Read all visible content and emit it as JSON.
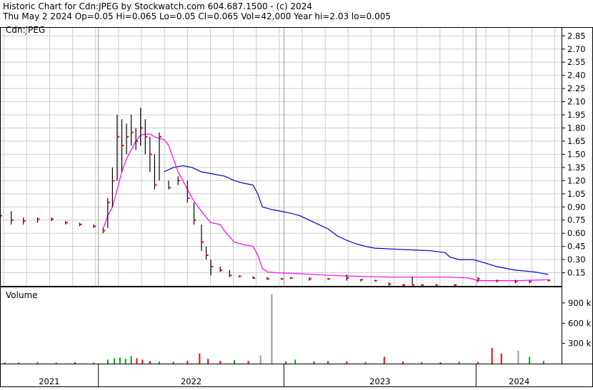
{
  "header": {
    "line1": "Historic Chart for Cdn:JPEG by Stockwatch.com 604.687.1500 - (c) 2024",
    "line2": "Thu May  2 2024  Op=0.05  Hi=0.065  Lo=0.05  Cl=0.065  Vol=42,000  Year hi=2.03  lo=0.005"
  },
  "colors": {
    "price_bar": "#000000",
    "close_mark": "#ff0000",
    "ma_short": "#ff00ff",
    "ma_long": "#0000cc",
    "volume_up": "#00aa00",
    "volume_down": "#ff0000",
    "volume_neutral": "#999999",
    "grid": "#cccccc",
    "frame": "#000000"
  },
  "chart_data": [
    {
      "type": "line",
      "title": "Cdn:JPEG",
      "ylim": [
        0,
        2.95
      ],
      "grid": true,
      "y_ticks": [
        "2.85",
        "2.70",
        "2.55",
        "2.40",
        "2.25",
        "2.10",
        "1.95",
        "1.80",
        "1.65",
        "1.50",
        "1.35",
        "1.20",
        "1.05",
        "0.90",
        "0.75",
        "0.60",
        "0.45",
        "0.30",
        "0.15"
      ],
      "x_period_labels": [
        "2021",
        "2022",
        "2023",
        "2024"
      ],
      "price_points_note": "",
      "price": [
        {
          "t": 0.0,
          "lo": 0.62,
          "hi": 1.0,
          "c": 0.8
        },
        {
          "t": 1.2,
          "lo": 0.7,
          "hi": 0.85,
          "c": 0.75
        },
        {
          "t": 2.5,
          "lo": 0.7,
          "hi": 0.78,
          "c": 0.74
        },
        {
          "t": 4.0,
          "lo": 0.72,
          "hi": 0.78,
          "c": 0.76
        },
        {
          "t": 5.5,
          "lo": 0.74,
          "hi": 0.78,
          "c": 0.76
        },
        {
          "t": 7.0,
          "lo": 0.7,
          "hi": 0.74,
          "c": 0.72
        },
        {
          "t": 8.5,
          "lo": 0.68,
          "hi": 0.72,
          "c": 0.7
        },
        {
          "t": 10.0,
          "lo": 0.66,
          "hi": 0.7,
          "c": 0.68
        },
        {
          "t": 11.0,
          "lo": 0.6,
          "hi": 0.66,
          "c": 0.63
        },
        {
          "t": 11.5,
          "lo": 0.66,
          "hi": 1.0,
          "c": 0.95
        },
        {
          "t": 12.0,
          "lo": 0.9,
          "hi": 1.35,
          "c": 1.2
        },
        {
          "t": 12.5,
          "lo": 1.2,
          "hi": 1.95,
          "c": 1.7
        },
        {
          "t": 13.0,
          "lo": 1.3,
          "hi": 1.9,
          "c": 1.6
        },
        {
          "t": 13.5,
          "lo": 1.5,
          "hi": 1.85,
          "c": 1.7
        },
        {
          "t": 14.0,
          "lo": 1.6,
          "hi": 1.95,
          "c": 1.75
        },
        {
          "t": 14.5,
          "lo": 1.55,
          "hi": 1.8,
          "c": 1.65
        },
        {
          "t": 15.0,
          "lo": 1.6,
          "hi": 2.03,
          "c": 1.8
        },
        {
          "t": 15.5,
          "lo": 1.5,
          "hi": 1.9,
          "c": 1.7
        },
        {
          "t": 16.0,
          "lo": 1.3,
          "hi": 1.7,
          "c": 1.5
        },
        {
          "t": 16.5,
          "lo": 1.1,
          "hi": 1.5,
          "c": 1.15
        },
        {
          "t": 17.0,
          "lo": 1.2,
          "hi": 1.75,
          "c": 1.7
        },
        {
          "t": 18.0,
          "lo": 1.1,
          "hi": 1.2,
          "c": 1.12
        },
        {
          "t": 19.0,
          "lo": 1.15,
          "hi": 1.25,
          "c": 1.2
        },
        {
          "t": 20.0,
          "lo": 0.95,
          "hi": 1.2,
          "c": 1.0
        },
        {
          "t": 20.7,
          "lo": 0.7,
          "hi": 0.95,
          "c": 0.75
        },
        {
          "t": 21.5,
          "lo": 0.4,
          "hi": 0.7,
          "c": 0.5
        },
        {
          "t": 22.0,
          "lo": 0.3,
          "hi": 0.45,
          "c": 0.35
        },
        {
          "t": 22.5,
          "lo": 0.12,
          "hi": 0.3,
          "c": 0.22
        },
        {
          "t": 23.5,
          "lo": 0.16,
          "hi": 0.22,
          "c": 0.18
        },
        {
          "t": 24.5,
          "lo": 0.1,
          "hi": 0.18,
          "c": 0.12
        },
        {
          "t": 25.5,
          "lo": 0.1,
          "hi": 0.12,
          "c": 0.11
        },
        {
          "t": 27.0,
          "lo": 0.08,
          "hi": 0.11,
          "c": 0.09
        },
        {
          "t": 28.5,
          "lo": 0.07,
          "hi": 0.1,
          "c": 0.08
        },
        {
          "t": 30.0,
          "lo": 0.07,
          "hi": 0.09,
          "c": 0.08
        },
        {
          "t": 31.0,
          "lo": 0.08,
          "hi": 0.1,
          "c": 0.09
        },
        {
          "t": 33.0,
          "lo": 0.06,
          "hi": 0.1,
          "c": 0.08
        },
        {
          "t": 35.0,
          "lo": 0.07,
          "hi": 0.09,
          "c": 0.08
        },
        {
          "t": 37.0,
          "lo": 0.06,
          "hi": 0.13,
          "c": 0.09
        },
        {
          "t": 38.5,
          "lo": 0.05,
          "hi": 0.08,
          "c": 0.07
        },
        {
          "t": 40.0,
          "lo": 0.05,
          "hi": 0.07,
          "c": 0.06
        },
        {
          "t": 41.5,
          "lo": 0.0,
          "hi": 0.04,
          "c": 0.02
        },
        {
          "t": 43.0,
          "lo": 0.0,
          "hi": 0.02,
          "c": 0.01
        },
        {
          "t": 44.0,
          "lo": 0.005,
          "hi": 0.1,
          "c": 0.01
        },
        {
          "t": 45.0,
          "lo": 0.0,
          "hi": 0.02,
          "c": 0.01
        },
        {
          "t": 46.5,
          "lo": 0.005,
          "hi": 0.02,
          "c": 0.01
        },
        {
          "t": 48.5,
          "lo": 0.0,
          "hi": 0.02,
          "c": 0.01
        },
        {
          "t": 51.0,
          "lo": 0.04,
          "hi": 0.1,
          "c": 0.08
        },
        {
          "t": 53.0,
          "lo": 0.04,
          "hi": 0.07,
          "c": 0.06
        },
        {
          "t": 55.0,
          "lo": 0.03,
          "hi": 0.07,
          "c": 0.05
        },
        {
          "t": 56.5,
          "lo": 0.03,
          "hi": 0.06,
          "c": 0.05
        },
        {
          "t": 58.5,
          "lo": 0.05,
          "hi": 0.065,
          "c": 0.065
        }
      ],
      "ma_short": [
        {
          "t": 11.0,
          "v": 0.65
        },
        {
          "t": 11.5,
          "v": 0.8
        },
        {
          "t": 12.0,
          "v": 0.9
        },
        {
          "t": 12.5,
          "v": 1.1
        },
        {
          "t": 13.0,
          "v": 1.3
        },
        {
          "t": 13.5,
          "v": 1.45
        },
        {
          "t": 14.0,
          "v": 1.55
        },
        {
          "t": 14.5,
          "v": 1.65
        },
        {
          "t": 15.0,
          "v": 1.72
        },
        {
          "t": 15.5,
          "v": 1.73
        },
        {
          "t": 16.0,
          "v": 1.73
        },
        {
          "t": 16.5,
          "v": 1.7
        },
        {
          "t": 17.0,
          "v": 1.68
        },
        {
          "t": 17.5,
          "v": 1.67
        },
        {
          "t": 18.0,
          "v": 1.6
        },
        {
          "t": 18.5,
          "v": 1.45
        },
        {
          "t": 19.0,
          "v": 1.3
        },
        {
          "t": 19.5,
          "v": 1.2
        },
        {
          "t": 20.0,
          "v": 1.1
        },
        {
          "t": 20.5,
          "v": 1.0
        },
        {
          "t": 21.0,
          "v": 0.92
        },
        {
          "t": 21.5,
          "v": 0.85
        },
        {
          "t": 22.0,
          "v": 0.78
        },
        {
          "t": 22.5,
          "v": 0.72
        },
        {
          "t": 23.5,
          "v": 0.7
        },
        {
          "t": 24.0,
          "v": 0.62
        },
        {
          "t": 25.0,
          "v": 0.5
        },
        {
          "t": 26.0,
          "v": 0.47
        },
        {
          "t": 27.0,
          "v": 0.45
        },
        {
          "t": 27.5,
          "v": 0.35
        },
        {
          "t": 28.0,
          "v": 0.2
        },
        {
          "t": 28.5,
          "v": 0.16
        },
        {
          "t": 29.5,
          "v": 0.15
        },
        {
          "t": 32.0,
          "v": 0.14
        },
        {
          "t": 35.0,
          "v": 0.12
        },
        {
          "t": 38.0,
          "v": 0.11
        },
        {
          "t": 42.0,
          "v": 0.1
        },
        {
          "t": 44.0,
          "v": 0.1
        },
        {
          "t": 48.0,
          "v": 0.1
        },
        {
          "t": 50.0,
          "v": 0.09
        },
        {
          "t": 51.0,
          "v": 0.06
        },
        {
          "t": 52.0,
          "v": 0.06
        },
        {
          "t": 55.0,
          "v": 0.06
        },
        {
          "t": 58.5,
          "v": 0.07
        }
      ],
      "ma_long": [
        {
          "t": 17.5,
          "v": 1.3
        },
        {
          "t": 18.5,
          "v": 1.35
        },
        {
          "t": 19.5,
          "v": 1.37
        },
        {
          "t": 20.5,
          "v": 1.35
        },
        {
          "t": 21.5,
          "v": 1.3
        },
        {
          "t": 22.5,
          "v": 1.28
        },
        {
          "t": 24.0,
          "v": 1.25
        },
        {
          "t": 25.0,
          "v": 1.2
        },
        {
          "t": 26.0,
          "v": 1.17
        },
        {
          "t": 27.0,
          "v": 1.15
        },
        {
          "t": 27.5,
          "v": 1.05
        },
        {
          "t": 28.0,
          "v": 0.9
        },
        {
          "t": 29.0,
          "v": 0.87
        },
        {
          "t": 30.0,
          "v": 0.85
        },
        {
          "t": 31.0,
          "v": 0.83
        },
        {
          "t": 32.0,
          "v": 0.8
        },
        {
          "t": 33.0,
          "v": 0.75
        },
        {
          "t": 34.0,
          "v": 0.7
        },
        {
          "t": 35.0,
          "v": 0.65
        },
        {
          "t": 36.0,
          "v": 0.57
        },
        {
          "t": 37.0,
          "v": 0.52
        },
        {
          "t": 38.0,
          "v": 0.48
        },
        {
          "t": 39.0,
          "v": 0.45
        },
        {
          "t": 40.0,
          "v": 0.43
        },
        {
          "t": 42.0,
          "v": 0.42
        },
        {
          "t": 44.0,
          "v": 0.41
        },
        {
          "t": 46.0,
          "v": 0.4
        },
        {
          "t": 47.5,
          "v": 0.38
        },
        {
          "t": 48.0,
          "v": 0.33
        },
        {
          "t": 49.0,
          "v": 0.3
        },
        {
          "t": 50.5,
          "v": 0.3
        },
        {
          "t": 51.5,
          "v": 0.27
        },
        {
          "t": 53.0,
          "v": 0.22
        },
        {
          "t": 55.0,
          "v": 0.18
        },
        {
          "t": 57.0,
          "v": 0.16
        },
        {
          "t": 58.5,
          "v": 0.13
        }
      ]
    },
    {
      "type": "bar",
      "title": "Volume",
      "ylim": [
        0,
        1100000
      ],
      "y_ticks": [
        "900 k",
        "600 k",
        "300 k"
      ],
      "volume": [
        {
          "t": 0.5,
          "v": 20000,
          "dir": "up"
        },
        {
          "t": 2.0,
          "v": 15000,
          "dir": "down"
        },
        {
          "t": 4.0,
          "v": 25000,
          "dir": "up"
        },
        {
          "t": 6.0,
          "v": 15000,
          "dir": "up"
        },
        {
          "t": 8.0,
          "v": 20000,
          "dir": "down"
        },
        {
          "t": 10.0,
          "v": 15000,
          "dir": "up"
        },
        {
          "t": 11.5,
          "v": 60000,
          "dir": "up"
        },
        {
          "t": 12.2,
          "v": 80000,
          "dir": "up"
        },
        {
          "t": 12.8,
          "v": 90000,
          "dir": "up"
        },
        {
          "t": 13.4,
          "v": 70000,
          "dir": "up"
        },
        {
          "t": 14.0,
          "v": 110000,
          "dir": "up"
        },
        {
          "t": 14.6,
          "v": 80000,
          "dir": "down"
        },
        {
          "t": 15.2,
          "v": 60000,
          "dir": "down"
        },
        {
          "t": 16.0,
          "v": 40000,
          "dir": "down"
        },
        {
          "t": 17.0,
          "v": 30000,
          "dir": "up"
        },
        {
          "t": 18.5,
          "v": 25000,
          "dir": "down"
        },
        {
          "t": 20.0,
          "v": 40000,
          "dir": "down"
        },
        {
          "t": 21.3,
          "v": 150000,
          "dir": "down"
        },
        {
          "t": 22.2,
          "v": 70000,
          "dir": "down"
        },
        {
          "t": 23.5,
          "v": 40000,
          "dir": "down"
        },
        {
          "t": 25.0,
          "v": 50000,
          "dir": "up"
        },
        {
          "t": 26.5,
          "v": 40000,
          "dir": "down"
        },
        {
          "t": 27.8,
          "v": 120000,
          "dir": "neutral"
        },
        {
          "t": 29.0,
          "v": 1030000,
          "dir": "neutral"
        },
        {
          "t": 30.5,
          "v": 30000,
          "dir": "down"
        },
        {
          "t": 31.5,
          "v": 60000,
          "dir": "up"
        },
        {
          "t": 33.5,
          "v": 30000,
          "dir": "down"
        },
        {
          "t": 35.0,
          "v": 40000,
          "dir": "up"
        },
        {
          "t": 37.0,
          "v": 30000,
          "dir": "down"
        },
        {
          "t": 39.0,
          "v": 25000,
          "dir": "up"
        },
        {
          "t": 41.0,
          "v": 100000,
          "dir": "down"
        },
        {
          "t": 43.0,
          "v": 30000,
          "dir": "down"
        },
        {
          "t": 45.0,
          "v": 25000,
          "dir": "up"
        },
        {
          "t": 47.0,
          "v": 20000,
          "dir": "down"
        },
        {
          "t": 49.0,
          "v": 30000,
          "dir": "up"
        },
        {
          "t": 51.0,
          "v": 25000,
          "dir": "down"
        },
        {
          "t": 52.5,
          "v": 230000,
          "dir": "down"
        },
        {
          "t": 53.5,
          "v": 150000,
          "dir": "down"
        },
        {
          "t": 55.3,
          "v": 190000,
          "dir": "neutral"
        },
        {
          "t": 56.5,
          "v": 100000,
          "dir": "up"
        },
        {
          "t": 58.0,
          "v": 40000,
          "dir": "up"
        }
      ]
    }
  ]
}
